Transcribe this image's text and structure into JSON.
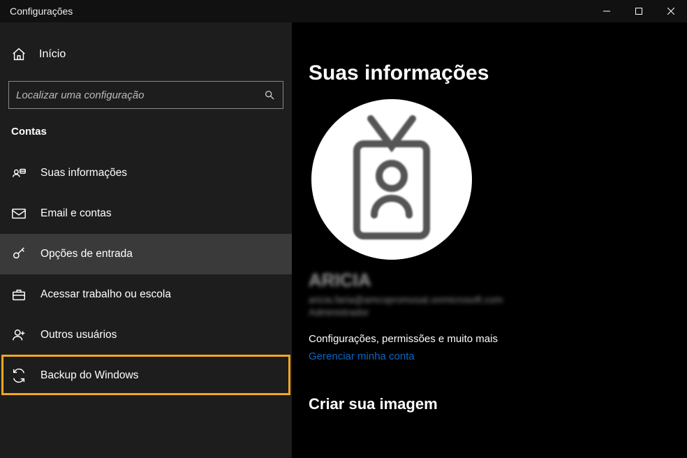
{
  "window": {
    "title": "Configurações"
  },
  "sidebar": {
    "home_label": "Início",
    "search_placeholder": "Localizar uma configuração",
    "section_label": "Contas",
    "items": [
      {
        "label": "Suas informações"
      },
      {
        "label": "Email e contas"
      },
      {
        "label": "Opções de entrada"
      },
      {
        "label": "Acessar trabalho ou escola"
      },
      {
        "label": "Outros usuários"
      },
      {
        "label": "Backup do Windows"
      }
    ]
  },
  "main": {
    "heading": "Suas informações",
    "user_name": "ARICIA",
    "user_email": "aricia.faria@amcopromosat.onmicrosoft.com",
    "user_role": "Administrador",
    "info_more": "Configurações, permissões e muito mais",
    "manage_link": "Gerenciar minha conta",
    "create_image_heading": "Criar sua imagem"
  },
  "annotation": {
    "highlighted_item_index": 4
  }
}
